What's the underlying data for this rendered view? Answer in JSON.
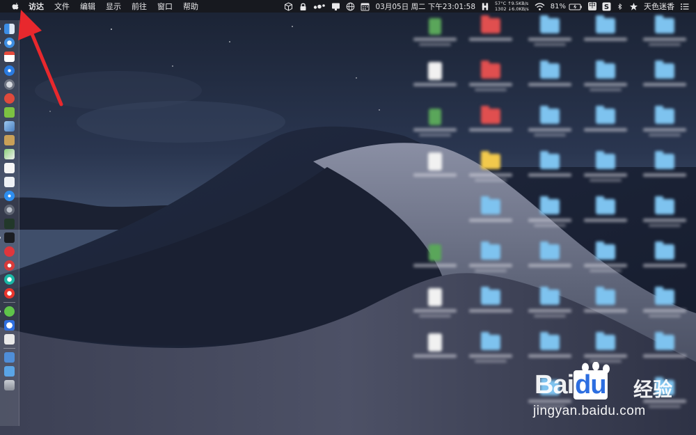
{
  "menubar": {
    "app_name": "访达",
    "menus": [
      "文件",
      "编辑",
      "显示",
      "前往",
      "窗口",
      "帮助"
    ],
    "status": {
      "cpu_temp": "57°C",
      "fan_rpm": "1302",
      "net_up": "↑9.5KB/s",
      "net_down": "↓6.0KB/s",
      "datetime": "03月05日 周二 下午23:01:58",
      "battery": "81%",
      "input_method": "中",
      "user": "天色迷香"
    }
  },
  "dock": {
    "icons": [
      "finder-icon",
      "safari-icon",
      "calendar-icon",
      "safari-compass-icon",
      "launchpad-icon",
      "netease-music-icon",
      "android-icon",
      "preview-icon",
      "notes-icon",
      "maps-icon",
      "textedit-icon",
      "document-icon",
      "app-store-icon",
      "system-preferences-icon",
      "activity-monitor-icon",
      "terminal-icon",
      "vivaldi-icon",
      "netease-cloud-music-icon",
      "sync-icon",
      "yandex-icon",
      "wechat-icon",
      "baidu-netdisk-icon",
      "script-editor-icon",
      "downloads-folder-icon",
      "folder-icon",
      "trash-icon"
    ]
  },
  "watermark": {
    "brand": "Bai",
    "brand_suffix": "du",
    "product": "经验",
    "url": "jingyan.baidu.com"
  },
  "colors": {
    "menubar_bg": "#17191f",
    "folder": "#7ec3ef",
    "arrow": "#e8282d"
  }
}
